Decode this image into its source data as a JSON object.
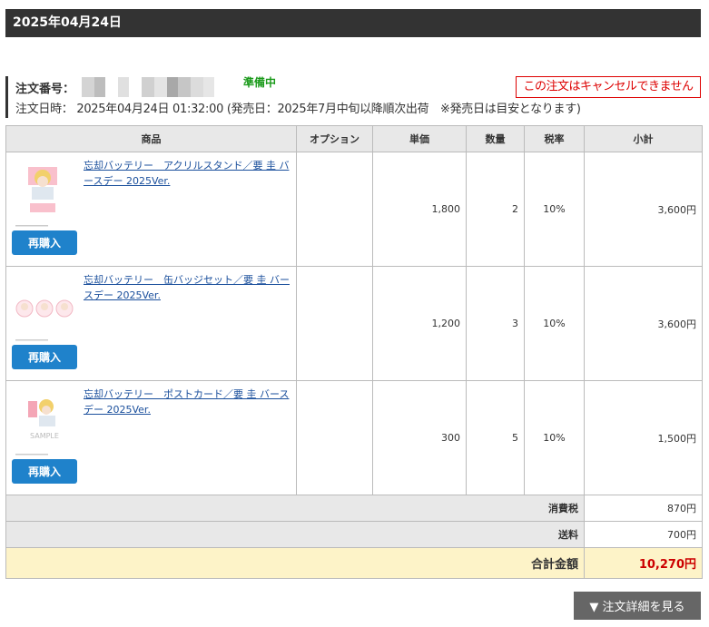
{
  "header": {
    "date": "2025年04月24日"
  },
  "order": {
    "number_label": "注文番号：",
    "status": "準備中",
    "date_label": "注文日時：",
    "date_value": "2025年04月24日 01:32:00 (発売日：2025年7月中旬以降順次出荷　※発売日は目安となります)",
    "cancel_notice": "この注文はキャンセルできません",
    "status_color": "#1a9a1a",
    "cancel_color": "#dd0000"
  },
  "table": {
    "headers": [
      "商品",
      "オプション",
      "単価",
      "数量",
      "税率",
      "小計"
    ],
    "rebuy_label": "再購入",
    "rows": [
      {
        "name": "忘却バッテリー　アクリルスタンド／要 圭 バースデー 2025Ver.",
        "option": "",
        "price": "1,800",
        "qty": "2",
        "tax": "10%",
        "subtotal": "3,600円",
        "thumb_icon": "acrylic-stand-thumbnail"
      },
      {
        "name": "忘却バッテリー　缶バッジセット／要 圭 バースデー 2025Ver.",
        "option": "",
        "price": "1,200",
        "qty": "3",
        "tax": "10%",
        "subtotal": "3,600円",
        "thumb_icon": "badge-set-thumbnail"
      },
      {
        "name": "忘却バッテリー　ポストカード／要 圭 バースデー 2025Ver.",
        "option": "",
        "price": "300",
        "qty": "5",
        "tax": "10%",
        "subtotal": "1,500円",
        "thumb_icon": "postcard-thumbnail",
        "thumb_text": "SAMPLE"
      }
    ],
    "tax_label": "消費税",
    "tax_value": "870円",
    "shipping_label": "送料",
    "shipping_value": "700円",
    "total_label": "合計金額",
    "total_value": "10,270円",
    "total_color": "#cc0000"
  },
  "detail_button": "▼ 注文詳細を見る"
}
